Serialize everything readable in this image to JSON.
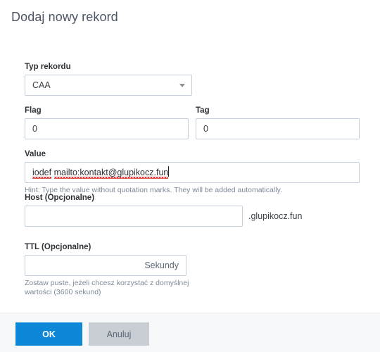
{
  "dialog": {
    "title": "Dodaj nowy rekord"
  },
  "form": {
    "record_type": {
      "label": "Typ rekordu",
      "value": "CAA",
      "caret_icon": "chevron-down-icon"
    },
    "flag": {
      "label": "Flag",
      "value": "0",
      "placeholder": ""
    },
    "tag": {
      "label": "Tag",
      "value": "0",
      "placeholder": ""
    },
    "value": {
      "label": "Value",
      "text_part_1": "iodef",
      "text_space": " ",
      "text_part_2": "mailto:kontakt@glupikocz.fun",
      "hint": "Hint: Type the value without quotation marks. They will be added automatically."
    },
    "host": {
      "label": "Host (Opcjonalne)",
      "value": "",
      "placeholder": "",
      "suffix": ".glupikocz.fun"
    },
    "ttl": {
      "label": "TTL (Opcjonalne)",
      "value": "",
      "placeholder": "",
      "suffix": "Sekundy",
      "hint": "Zostaw puste, jeżeli chcesz korzystać z domyślnej wartości (3600 sekund)"
    }
  },
  "footer": {
    "ok_label": "OK",
    "cancel_label": "Anuluj"
  },
  "colors": {
    "primary": "#0d88d8",
    "cancel": "#c9ced4",
    "border": "#c5cfdb",
    "hint": "#7e8a99",
    "spellcheck": "#e02020"
  }
}
